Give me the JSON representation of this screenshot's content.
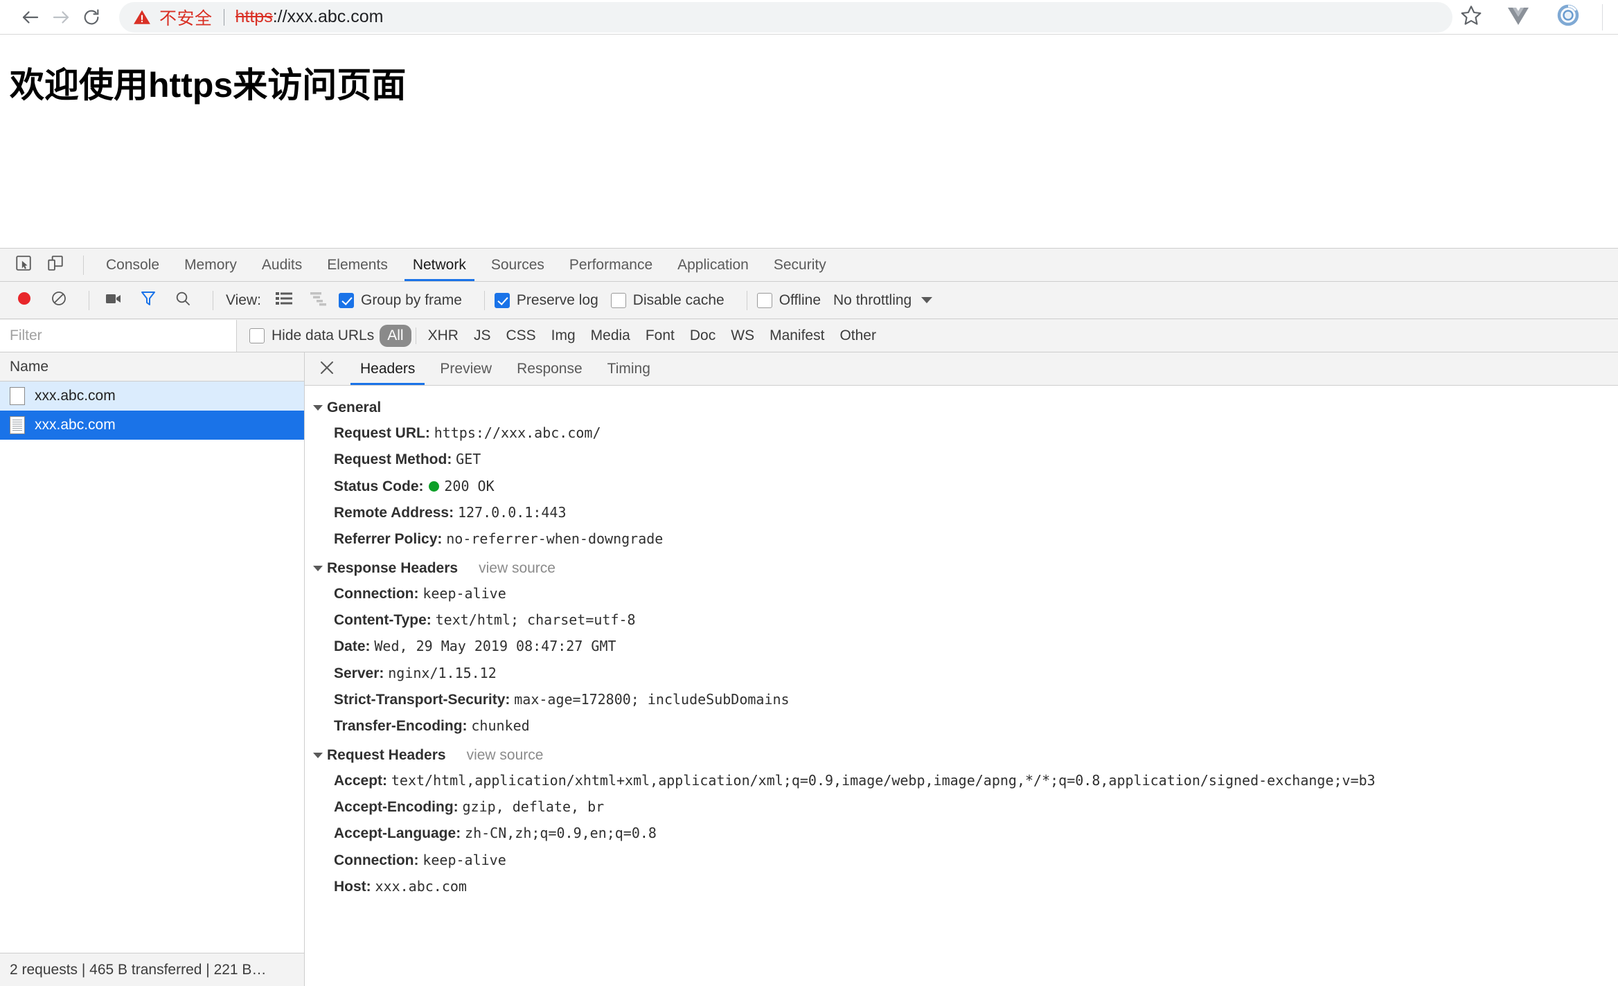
{
  "browser": {
    "back_icon": "arrow-left-icon",
    "forward_icon": "arrow-right-icon",
    "reload_icon": "reload-icon",
    "security_label": "不安全",
    "url_scheme": "https",
    "url_rest": "://xxx.abc.com",
    "star_icon": "star-icon",
    "ext_vue_icon": "vue-devtools-icon",
    "ext_blue_icon": "browser-extension-icon",
    "accent_red": "#d93025",
    "omnibox_bg": "#f1f3f4"
  },
  "page": {
    "heading": "欢迎使用https来访问页面"
  },
  "devtools": {
    "inspect_icon": "inspect-element-icon",
    "device_icon": "device-toolbar-icon",
    "tabs": [
      {
        "label": "Console",
        "active": false
      },
      {
        "label": "Memory",
        "active": false
      },
      {
        "label": "Audits",
        "active": false
      },
      {
        "label": "Elements",
        "active": false
      },
      {
        "label": "Network",
        "active": true
      },
      {
        "label": "Sources",
        "active": false
      },
      {
        "label": "Performance",
        "active": false
      },
      {
        "label": "Application",
        "active": false
      },
      {
        "label": "Security",
        "active": false
      }
    ],
    "accent_blue": "#1a73e8",
    "toolbar": {
      "record_icon": "record-button-icon",
      "clear_icon": "clear-icon",
      "capture_screenshots_icon": "camera-icon",
      "filter_icon": "funnel-icon",
      "search_icon": "search-icon",
      "view_label": "View:",
      "view_list_icon": "list-view-icon",
      "view_waterfall_icon": "waterfall-view-icon",
      "group_by_frame": {
        "label": "Group by frame",
        "checked": true
      },
      "preserve_log": {
        "label": "Preserve log",
        "checked": true
      },
      "disable_cache": {
        "label": "Disable cache",
        "checked": false
      },
      "offline": {
        "label": "Offline",
        "checked": false
      },
      "throttling": "No throttling",
      "throttling_caret_icon": "chevron-down-icon"
    },
    "filterbar": {
      "filter_placeholder": "Filter",
      "filter_value": "",
      "hide_data_urls": {
        "label": "Hide data URLs",
        "checked": false
      },
      "types": [
        {
          "label": "All",
          "active": true
        },
        {
          "label": "XHR",
          "active": false
        },
        {
          "label": "JS",
          "active": false
        },
        {
          "label": "CSS",
          "active": false
        },
        {
          "label": "Img",
          "active": false
        },
        {
          "label": "Media",
          "active": false
        },
        {
          "label": "Font",
          "active": false
        },
        {
          "label": "Doc",
          "active": false
        },
        {
          "label": "WS",
          "active": false
        },
        {
          "label": "Manifest",
          "active": false
        },
        {
          "label": "Other",
          "active": false
        }
      ]
    },
    "requests": {
      "column_name": "Name",
      "rows": [
        {
          "name": "xxx.abc.com",
          "state": "hovered"
        },
        {
          "name": "xxx.abc.com",
          "state": "selected"
        }
      ],
      "status": "2 requests | 465 B transferred | 221 B…"
    },
    "detail": {
      "close_icon": "close-icon",
      "tabs": [
        {
          "label": "Headers",
          "active": true
        },
        {
          "label": "Preview",
          "active": false
        },
        {
          "label": "Response",
          "active": false
        },
        {
          "label": "Timing",
          "active": false
        }
      ],
      "sections": [
        {
          "title": "General",
          "view_source": "",
          "rows": [
            {
              "name": "Request URL:",
              "value": "https://xxx.abc.com/"
            },
            {
              "name": "Request Method:",
              "value": "GET"
            },
            {
              "name": "Status Code:",
              "value": "200 OK",
              "status_dot": "#0d9f28"
            },
            {
              "name": "Remote Address:",
              "value": "127.0.0.1:443"
            },
            {
              "name": "Referrer Policy:",
              "value": "no-referrer-when-downgrade"
            }
          ]
        },
        {
          "title": "Response Headers",
          "view_source": "view source",
          "rows": [
            {
              "name": "Connection:",
              "value": "keep-alive"
            },
            {
              "name": "Content-Type:",
              "value": "text/html; charset=utf-8"
            },
            {
              "name": "Date:",
              "value": "Wed, 29 May 2019 08:47:27 GMT"
            },
            {
              "name": "Server:",
              "value": "nginx/1.15.12"
            },
            {
              "name": "Strict-Transport-Security:",
              "value": "max-age=172800; includeSubDomains"
            },
            {
              "name": "Transfer-Encoding:",
              "value": "chunked"
            }
          ]
        },
        {
          "title": "Request Headers",
          "view_source": "view source",
          "rows": [
            {
              "name": "Accept:",
              "value": "text/html,application/xhtml+xml,application/xml;q=0.9,image/webp,image/apng,*/*;q=0.8,application/signed-exchange;v=b3"
            },
            {
              "name": "Accept-Encoding:",
              "value": "gzip, deflate, br"
            },
            {
              "name": "Accept-Language:",
              "value": "zh-CN,zh;q=0.9,en;q=0.8"
            },
            {
              "name": "Connection:",
              "value": "keep-alive"
            },
            {
              "name": "Host:",
              "value": "xxx.abc.com"
            }
          ]
        }
      ]
    }
  }
}
